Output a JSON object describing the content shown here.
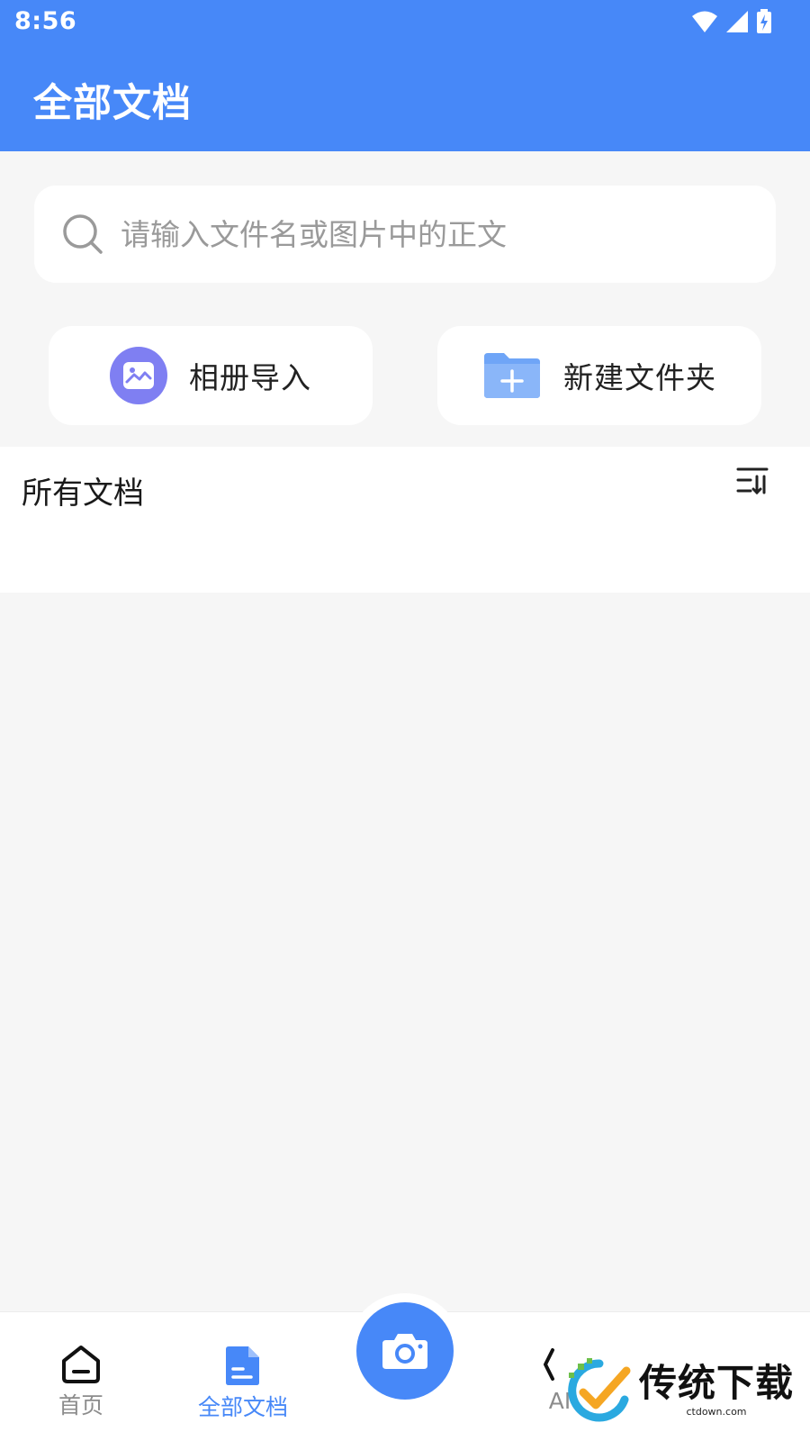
{
  "status_bar": {
    "time": "8:56"
  },
  "header": {
    "title": "全部文档"
  },
  "search": {
    "placeholder": "请输入文件名或图片中的正文",
    "value": ""
  },
  "actions": [
    {
      "label": "相册导入",
      "icon": "photo-album-icon"
    },
    {
      "label": "新建文件夹",
      "icon": "folder-plus-icon"
    }
  ],
  "documents": {
    "section_title": "所有文档",
    "sort_icon": "sort-icon",
    "items": []
  },
  "bottom_nav": {
    "items": [
      {
        "label": "首页",
        "icon": "home-icon",
        "active": false
      },
      {
        "label": "全部文档",
        "icon": "document-icon",
        "active": true
      },
      {
        "label": "AI",
        "icon": "ai-icon",
        "active": false
      }
    ],
    "center_action": {
      "icon": "camera-icon"
    }
  },
  "watermark": {
    "text": "传统下载",
    "subtext": "ctdown.com"
  },
  "colors": {
    "primary": "#4788f8",
    "background": "#f6f6f6",
    "photo_icon_bg": "#7f7ff2",
    "folder": "#6fa5f7"
  }
}
